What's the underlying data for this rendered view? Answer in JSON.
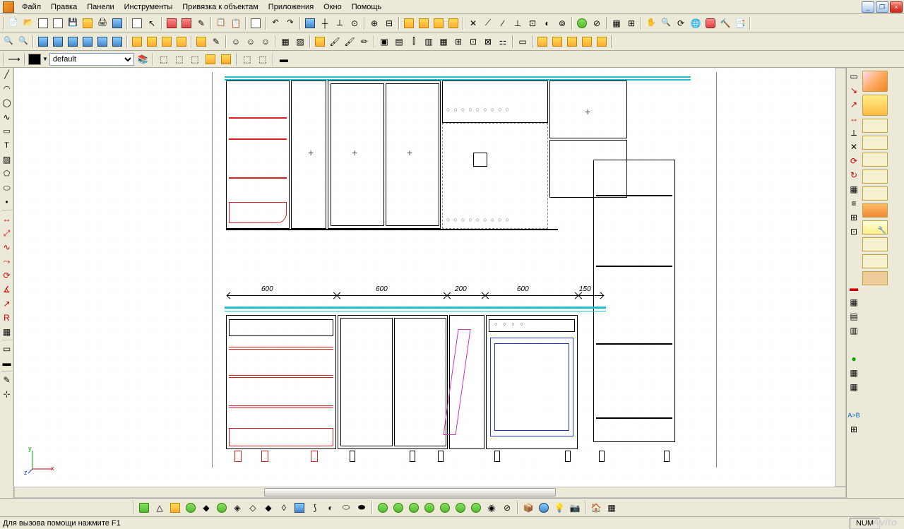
{
  "menu": {
    "items": [
      "Файл",
      "Правка",
      "Панели",
      "Инструменты",
      "Привязка к объектам",
      "Приложения",
      "Окно",
      "Помощь"
    ]
  },
  "layer": {
    "selected": "default"
  },
  "dimensions": {
    "d1": "600",
    "d2": "600",
    "d3": "200",
    "d4": "600",
    "d5": "150"
  },
  "status": {
    "help": "Для вызова помощи нажмите F1",
    "num": "NUM"
  },
  "axes": {
    "x": "x",
    "y": "y",
    "z": "z"
  },
  "watermark": "Avito"
}
